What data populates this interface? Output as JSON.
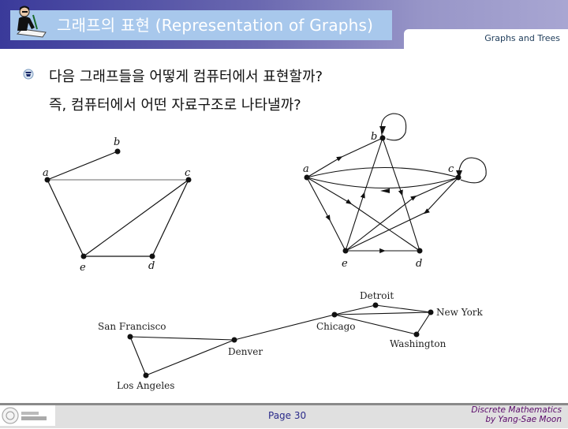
{
  "header": {
    "title": "그래프의 표현 (Representation of Graphs)",
    "section": "Graphs and Trees",
    "logo_icon": "person-writing-icon"
  },
  "content": {
    "bullet_icon": "bullet-emblem-icon",
    "question_line1": "다음 그래프들을 어떻게 컴퓨터에서 표현할까?",
    "question_line2": "즉, 컴퓨터에서 어떤 자료구조로 나타낼까?"
  },
  "graph1": {
    "type": "undirected",
    "nodes": [
      "a",
      "b",
      "c",
      "d",
      "e"
    ],
    "edges": [
      [
        "a",
        "b"
      ],
      [
        "a",
        "c"
      ],
      [
        "a",
        "e"
      ],
      [
        "c",
        "e"
      ],
      [
        "c",
        "d"
      ],
      [
        "e",
        "d"
      ]
    ]
  },
  "graph2": {
    "type": "directed",
    "nodes": [
      "a",
      "b",
      "c",
      "d",
      "e"
    ],
    "edges": [
      [
        "a",
        "b"
      ],
      [
        "a",
        "c"
      ],
      [
        "c",
        "a"
      ],
      [
        "a",
        "e"
      ],
      [
        "a",
        "d"
      ],
      [
        "b",
        "b"
      ],
      [
        "b",
        "d"
      ],
      [
        "e",
        "b"
      ],
      [
        "c",
        "c"
      ],
      [
        "e",
        "c"
      ],
      [
        "c",
        "e"
      ],
      [
        "e",
        "d"
      ]
    ]
  },
  "graph3": {
    "type": "undirected",
    "nodes": [
      "San Francisco",
      "Los Angeles",
      "Denver",
      "Chicago",
      "Detroit",
      "New York",
      "Washington"
    ],
    "edges": [
      [
        "San Francisco",
        "Denver"
      ],
      [
        "San Francisco",
        "Los Angeles"
      ],
      [
        "Los Angeles",
        "Denver"
      ],
      [
        "Denver",
        "Chicago"
      ],
      [
        "Chicago",
        "Detroit"
      ],
      [
        "Chicago",
        "New York"
      ],
      [
        "Detroit",
        "New York"
      ],
      [
        "Chicago",
        "Washington"
      ],
      [
        "Washington",
        "New York"
      ]
    ]
  },
  "footer": {
    "page": "Page 30",
    "credit_line1": "Discrete Mathematics",
    "credit_line2": "by Yang-Sae Moon",
    "university_logo": "university-seal-icon"
  }
}
